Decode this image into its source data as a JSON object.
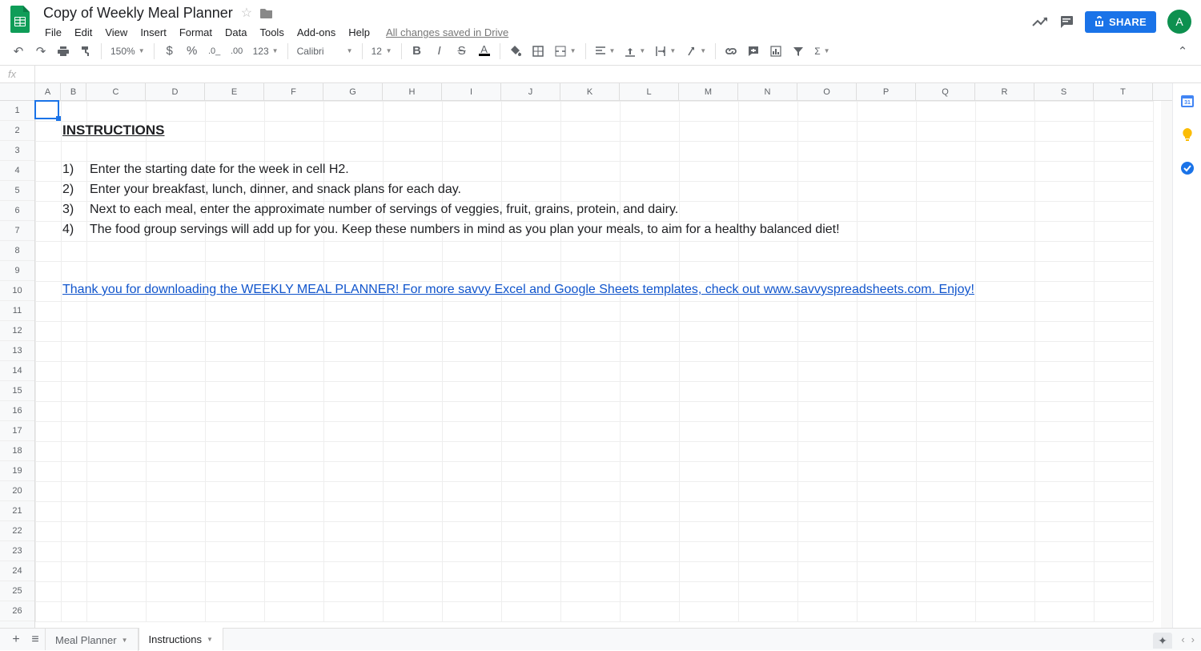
{
  "doc": {
    "title": "Copy of Weekly Meal Planner",
    "save_status": "All changes saved in Drive"
  },
  "menu": [
    "File",
    "Edit",
    "View",
    "Insert",
    "Format",
    "Data",
    "Tools",
    "Add-ons",
    "Help"
  ],
  "toolbar": {
    "zoom": "150%",
    "font": "Calibri",
    "font_size": "12"
  },
  "share": {
    "label": "SHARE"
  },
  "avatar": {
    "letter": "A"
  },
  "formula": {
    "fx": "fx",
    "value": ""
  },
  "columns": [
    "A",
    "B",
    "C",
    "D",
    "E",
    "F",
    "G",
    "H",
    "I",
    "J",
    "K",
    "L",
    "M",
    "N",
    "O",
    "P",
    "Q",
    "R",
    "S",
    "T"
  ],
  "rows_count": 26,
  "col_widths": {
    "A": 32,
    "B": 32,
    "default": 74
  },
  "selection": {
    "col": "A",
    "row": 1
  },
  "content": {
    "heading": "INSTRUCTIONS",
    "items": [
      {
        "num": "1)",
        "text": "Enter the starting date for the week in cell H2."
      },
      {
        "num": "2)",
        "text": "Enter your breakfast, lunch, dinner, and snack plans for each day."
      },
      {
        "num": "3)",
        "text": "Next to each meal, enter the approximate number of servings of veggies, fruit, grains, protein, and dairy."
      },
      {
        "num": "4)",
        "text": "The food group servings will add up for you.  Keep these numbers in mind as you plan your meals, to aim for a healthy balanced diet!"
      }
    ],
    "link_text": "Thank you for downloading the WEEKLY MEAL PLANNER!  For more savvy Excel and Google Sheets templates, check out www.savvyspreadsheets.com.  Enjoy!"
  },
  "sheet_tabs": [
    {
      "name": "Meal Planner",
      "active": false
    },
    {
      "name": "Instructions",
      "active": true
    }
  ]
}
